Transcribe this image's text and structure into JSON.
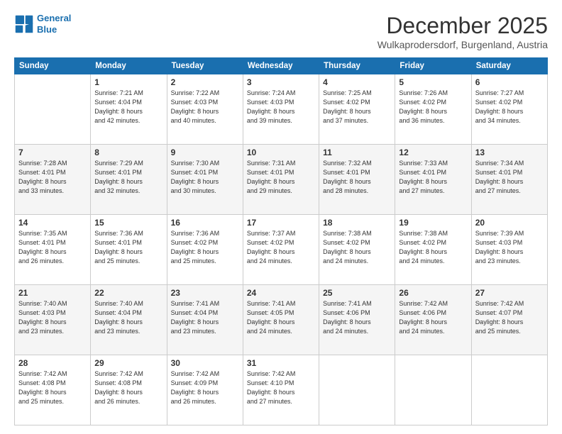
{
  "logo": {
    "line1": "General",
    "line2": "Blue"
  },
  "header": {
    "month": "December 2025",
    "location": "Wulkaprodersdorf, Burgenland, Austria"
  },
  "weekdays": [
    "Sunday",
    "Monday",
    "Tuesday",
    "Wednesday",
    "Thursday",
    "Friday",
    "Saturday"
  ],
  "weeks": [
    [
      {
        "day": "",
        "info": ""
      },
      {
        "day": "1",
        "info": "Sunrise: 7:21 AM\nSunset: 4:04 PM\nDaylight: 8 hours\nand 42 minutes."
      },
      {
        "day": "2",
        "info": "Sunrise: 7:22 AM\nSunset: 4:03 PM\nDaylight: 8 hours\nand 40 minutes."
      },
      {
        "day": "3",
        "info": "Sunrise: 7:24 AM\nSunset: 4:03 PM\nDaylight: 8 hours\nand 39 minutes."
      },
      {
        "day": "4",
        "info": "Sunrise: 7:25 AM\nSunset: 4:02 PM\nDaylight: 8 hours\nand 37 minutes."
      },
      {
        "day": "5",
        "info": "Sunrise: 7:26 AM\nSunset: 4:02 PM\nDaylight: 8 hours\nand 36 minutes."
      },
      {
        "day": "6",
        "info": "Sunrise: 7:27 AM\nSunset: 4:02 PM\nDaylight: 8 hours\nand 34 minutes."
      }
    ],
    [
      {
        "day": "7",
        "info": "Sunrise: 7:28 AM\nSunset: 4:01 PM\nDaylight: 8 hours\nand 33 minutes."
      },
      {
        "day": "8",
        "info": "Sunrise: 7:29 AM\nSunset: 4:01 PM\nDaylight: 8 hours\nand 32 minutes."
      },
      {
        "day": "9",
        "info": "Sunrise: 7:30 AM\nSunset: 4:01 PM\nDaylight: 8 hours\nand 30 minutes."
      },
      {
        "day": "10",
        "info": "Sunrise: 7:31 AM\nSunset: 4:01 PM\nDaylight: 8 hours\nand 29 minutes."
      },
      {
        "day": "11",
        "info": "Sunrise: 7:32 AM\nSunset: 4:01 PM\nDaylight: 8 hours\nand 28 minutes."
      },
      {
        "day": "12",
        "info": "Sunrise: 7:33 AM\nSunset: 4:01 PM\nDaylight: 8 hours\nand 27 minutes."
      },
      {
        "day": "13",
        "info": "Sunrise: 7:34 AM\nSunset: 4:01 PM\nDaylight: 8 hours\nand 27 minutes."
      }
    ],
    [
      {
        "day": "14",
        "info": "Sunrise: 7:35 AM\nSunset: 4:01 PM\nDaylight: 8 hours\nand 26 minutes."
      },
      {
        "day": "15",
        "info": "Sunrise: 7:36 AM\nSunset: 4:01 PM\nDaylight: 8 hours\nand 25 minutes."
      },
      {
        "day": "16",
        "info": "Sunrise: 7:36 AM\nSunset: 4:02 PM\nDaylight: 8 hours\nand 25 minutes."
      },
      {
        "day": "17",
        "info": "Sunrise: 7:37 AM\nSunset: 4:02 PM\nDaylight: 8 hours\nand 24 minutes."
      },
      {
        "day": "18",
        "info": "Sunrise: 7:38 AM\nSunset: 4:02 PM\nDaylight: 8 hours\nand 24 minutes."
      },
      {
        "day": "19",
        "info": "Sunrise: 7:38 AM\nSunset: 4:02 PM\nDaylight: 8 hours\nand 24 minutes."
      },
      {
        "day": "20",
        "info": "Sunrise: 7:39 AM\nSunset: 4:03 PM\nDaylight: 8 hours\nand 23 minutes."
      }
    ],
    [
      {
        "day": "21",
        "info": "Sunrise: 7:40 AM\nSunset: 4:03 PM\nDaylight: 8 hours\nand 23 minutes."
      },
      {
        "day": "22",
        "info": "Sunrise: 7:40 AM\nSunset: 4:04 PM\nDaylight: 8 hours\nand 23 minutes."
      },
      {
        "day": "23",
        "info": "Sunrise: 7:41 AM\nSunset: 4:04 PM\nDaylight: 8 hours\nand 23 minutes."
      },
      {
        "day": "24",
        "info": "Sunrise: 7:41 AM\nSunset: 4:05 PM\nDaylight: 8 hours\nand 24 minutes."
      },
      {
        "day": "25",
        "info": "Sunrise: 7:41 AM\nSunset: 4:06 PM\nDaylight: 8 hours\nand 24 minutes."
      },
      {
        "day": "26",
        "info": "Sunrise: 7:42 AM\nSunset: 4:06 PM\nDaylight: 8 hours\nand 24 minutes."
      },
      {
        "day": "27",
        "info": "Sunrise: 7:42 AM\nSunset: 4:07 PM\nDaylight: 8 hours\nand 25 minutes."
      }
    ],
    [
      {
        "day": "28",
        "info": "Sunrise: 7:42 AM\nSunset: 4:08 PM\nDaylight: 8 hours\nand 25 minutes."
      },
      {
        "day": "29",
        "info": "Sunrise: 7:42 AM\nSunset: 4:08 PM\nDaylight: 8 hours\nand 26 minutes."
      },
      {
        "day": "30",
        "info": "Sunrise: 7:42 AM\nSunset: 4:09 PM\nDaylight: 8 hours\nand 26 minutes."
      },
      {
        "day": "31",
        "info": "Sunrise: 7:42 AM\nSunset: 4:10 PM\nDaylight: 8 hours\nand 27 minutes."
      },
      {
        "day": "",
        "info": ""
      },
      {
        "day": "",
        "info": ""
      },
      {
        "day": "",
        "info": ""
      }
    ]
  ]
}
